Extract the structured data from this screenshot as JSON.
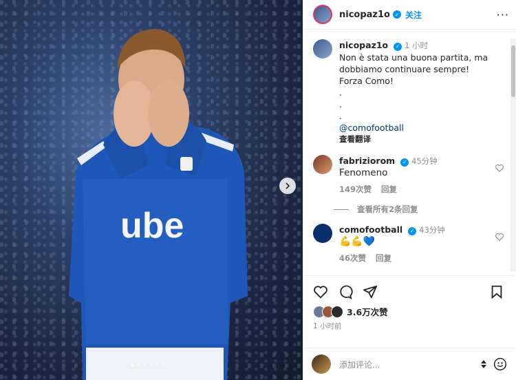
{
  "post": {
    "author": "nicopaz1o",
    "follow_label": "关注",
    "caption_author": "nicopaz1o",
    "caption_time": "1 小时",
    "caption_lines": [
      "Non è stata una buona partita, ma",
      "dobbiamo continuare sempre!",
      "Forza Como!",
      ".",
      ".",
      "."
    ],
    "mention": "@comofootball",
    "see_translation": "查看翻译"
  },
  "comments": [
    {
      "user": "fabriziorom",
      "time": "45分钟",
      "text": "Fenomeno",
      "likes": "149次赞",
      "reply": "回复",
      "view_replies": "查看所有2条回复"
    },
    {
      "user": "comofootball",
      "time": "43分钟",
      "text": "💪💪💙",
      "likes": "46次赞",
      "reply": "回复"
    }
  ],
  "likes": {
    "count": "3.6万次赞",
    "time": "1 小时前"
  },
  "comment_box": {
    "placeholder": "添加评论..."
  },
  "photo": {
    "jersey_text": "ube"
  },
  "colors": {
    "accent": "#0095f6",
    "jersey": "#1f57b8"
  }
}
